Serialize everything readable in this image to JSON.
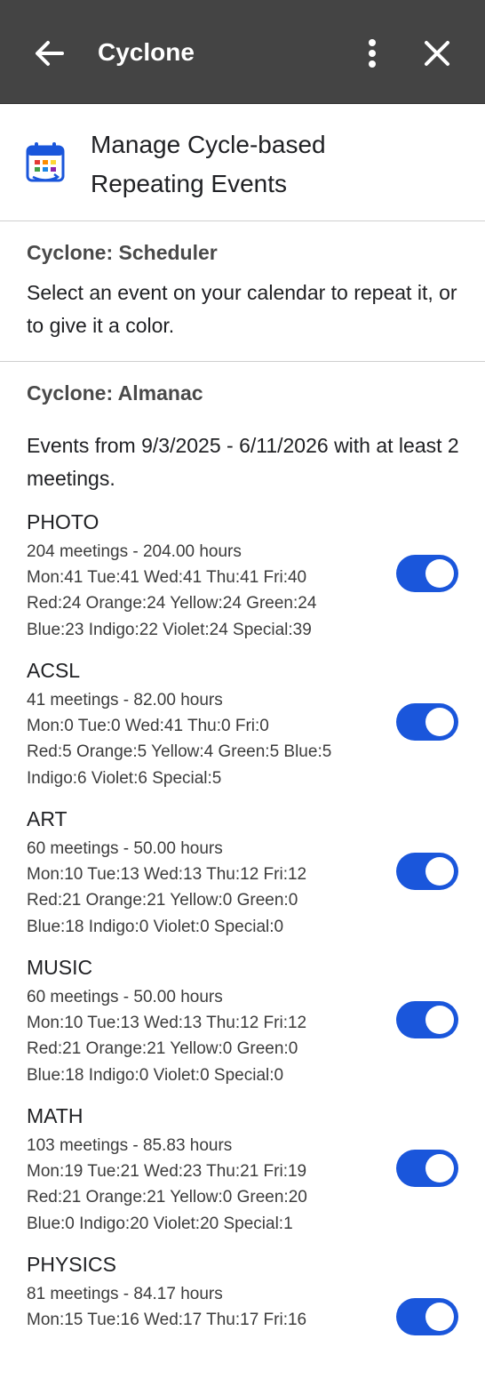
{
  "topbar": {
    "title": "Cyclone"
  },
  "addon": {
    "name_line1": "Manage Cycle-based",
    "name_line2": "Repeating Events"
  },
  "scheduler": {
    "title": "Cyclone: Scheduler",
    "description": "Select an event on your calendar to repeat it, or to give it a color."
  },
  "almanac": {
    "title": "Cyclone: Almanac",
    "intro": "Events from 9/3/2025 - 6/11/2026 with at least 2 meetings.",
    "events": [
      {
        "name": "PHOTO",
        "line1": "204 meetings - 204.00 hours",
        "line2": "Mon:41 Tue:41 Wed:41 Thu:41 Fri:40",
        "line3": "Red:24 Orange:24 Yellow:24 Green:24",
        "line4": "Blue:23 Indigo:22 Violet:24 Special:39",
        "enabled": true
      },
      {
        "name": "ACSL",
        "line1": "41 meetings - 82.00 hours",
        "line2": "Mon:0 Tue:0 Wed:41 Thu:0 Fri:0",
        "line3": "Red:5 Orange:5 Yellow:4 Green:5 Blue:5",
        "line4": "Indigo:6 Violet:6 Special:5",
        "enabled": true
      },
      {
        "name": "ART",
        "line1": "60 meetings - 50.00 hours",
        "line2": "Mon:10 Tue:13 Wed:13 Thu:12 Fri:12",
        "line3": "Red:21 Orange:21 Yellow:0 Green:0",
        "line4": "Blue:18 Indigo:0 Violet:0 Special:0",
        "enabled": true
      },
      {
        "name": "MUSIC",
        "line1": "60 meetings - 50.00 hours",
        "line2": "Mon:10 Tue:13 Wed:13 Thu:12 Fri:12",
        "line3": "Red:21 Orange:21 Yellow:0 Green:0",
        "line4": "Blue:18 Indigo:0 Violet:0 Special:0",
        "enabled": true
      },
      {
        "name": "MATH",
        "line1": "103 meetings - 85.83 hours",
        "line2": "Mon:19 Tue:21 Wed:23 Thu:21 Fri:19",
        "line3": "Red:21 Orange:21 Yellow:0 Green:20",
        "line4": "Blue:0 Indigo:20 Violet:20 Special:1",
        "enabled": true
      },
      {
        "name": "PHYSICS",
        "line1": "81 meetings - 84.17 hours",
        "line2": "Mon:15 Tue:16 Wed:17 Thu:17 Fri:16",
        "line3": "",
        "line4": "",
        "enabled": true
      }
    ]
  },
  "icons": {
    "back": "arrow-left-icon",
    "more": "more-vert-icon",
    "close": "close-icon",
    "logo": "calendar-logo-icon"
  },
  "colors": {
    "topbar": "#444444",
    "toggle_on": "#1a56db"
  }
}
